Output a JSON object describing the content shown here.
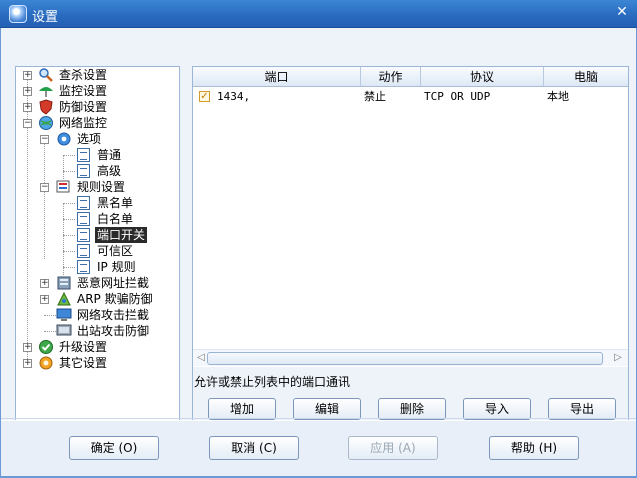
{
  "window": {
    "title": "设置",
    "close_label": "✕"
  },
  "tree": {
    "items": [
      {
        "label": "查杀设置",
        "icon": "magnifier-icon"
      },
      {
        "label": "监控设置",
        "icon": "umbrella-icon"
      },
      {
        "label": "防御设置",
        "icon": "shield-icon"
      },
      {
        "label": "网络监控",
        "icon": "globe-icon"
      },
      {
        "label": "选项",
        "icon": "gear-icon"
      },
      {
        "label": "普通",
        "icon": "document-icon"
      },
      {
        "label": "高级",
        "icon": "document-icon"
      },
      {
        "label": "规则设置",
        "icon": "rules-icon"
      },
      {
        "label": "黑名单",
        "icon": "document-icon"
      },
      {
        "label": "白名单",
        "icon": "document-icon"
      },
      {
        "label": "端口开关",
        "icon": "document-icon"
      },
      {
        "label": "可信区",
        "icon": "document-icon"
      },
      {
        "label": "IP 规则",
        "icon": "document-icon"
      },
      {
        "label": "恶意网址拦截",
        "icon": "server-icon"
      },
      {
        "label": "ARP 欺骗防御",
        "icon": "arp-icon"
      },
      {
        "label": "网络攻击拦截",
        "icon": "monitor-icon"
      },
      {
        "label": "出站攻击防御",
        "icon": "outbound-icon"
      },
      {
        "label": "升级设置",
        "icon": "check-icon"
      },
      {
        "label": "其它设置",
        "icon": "settings-icon"
      }
    ]
  },
  "table": {
    "columns": [
      "端口",
      "动作",
      "协议",
      "电脑"
    ],
    "rows": [
      {
        "port": "1434,",
        "action": "禁止",
        "protocol": "TCP OR UDP",
        "computer": "本地",
        "checked": true
      }
    ]
  },
  "description": "允许或禁止列表中的端口通讯",
  "buttons": {
    "add": "增加",
    "edit": "编辑",
    "delete": "删除",
    "import": "导入",
    "export": "导出"
  },
  "footer": {
    "ok": "确定 (O)",
    "cancel": "取消 (C)",
    "apply": "应用 (A)",
    "help": "帮助 (H)"
  },
  "colors": {
    "titlebar": "#2a6cc0",
    "selection": "#2a2a2a",
    "checkbox": "#d49a2a"
  }
}
